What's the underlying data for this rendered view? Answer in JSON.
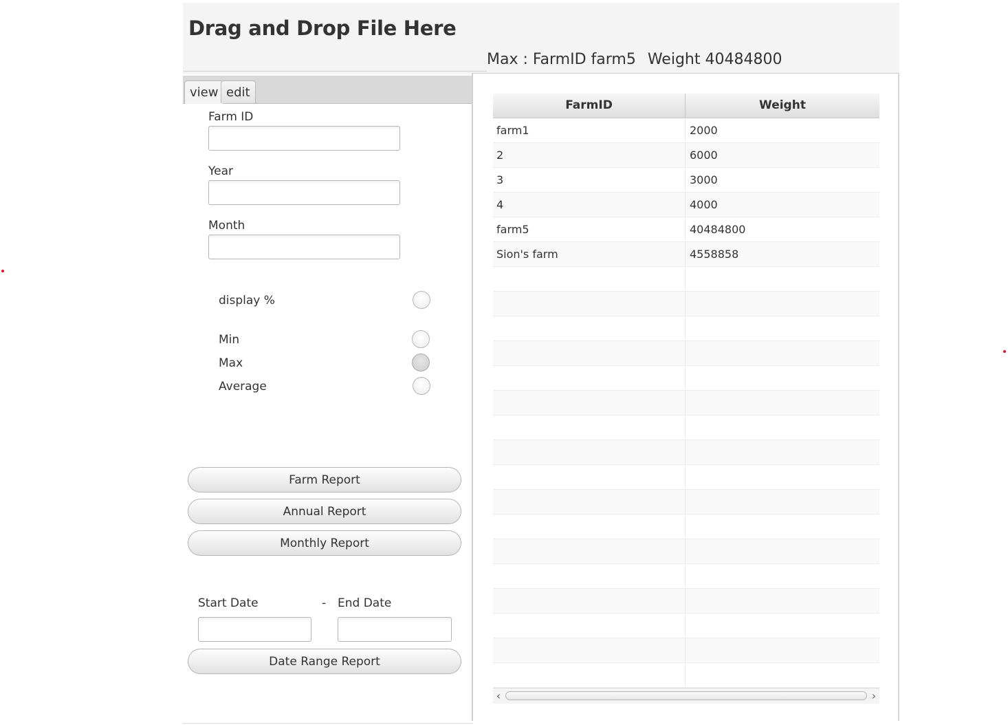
{
  "header": {
    "title": "Drag and Drop File Here",
    "max_label": "Max : FarmID farm5",
    "max_weight": "Weight 40484800"
  },
  "tabs": [
    {
      "label": "view",
      "active": true
    },
    {
      "label": "edit",
      "active": false
    }
  ],
  "form": {
    "farm_id_label": "Farm ID",
    "farm_id_value": "",
    "year_label": "Year",
    "year_value": "",
    "month_label": "Month",
    "month_value": "",
    "display_percent_label": "display %",
    "min_label": "Min",
    "max_label": "Max",
    "average_label": "Average",
    "selected_stat": "Max"
  },
  "buttons": {
    "farm_report": "Farm Report",
    "annual_report": "Annual Report",
    "monthly_report": "Monthly Report",
    "date_range_report": "Date Range Report"
  },
  "date_range": {
    "start_label": "Start Date",
    "separator": "-",
    "end_label": "End Date",
    "start_value": "",
    "end_value": ""
  },
  "table": {
    "columns": [
      "FarmID",
      "Weight"
    ],
    "rows": [
      {
        "farm_id": "farm1",
        "weight": "2000"
      },
      {
        "farm_id": "2",
        "weight": "6000"
      },
      {
        "farm_id": "3",
        "weight": "3000"
      },
      {
        "farm_id": "4",
        "weight": "4000"
      },
      {
        "farm_id": "farm5",
        "weight": "40484800"
      },
      {
        "farm_id": "Sion's farm",
        "weight": "4558858"
      }
    ],
    "empty_rows": 17
  },
  "colors": {
    "marker_dot": "#e0141e",
    "header_bg": "#f4f4f4"
  }
}
